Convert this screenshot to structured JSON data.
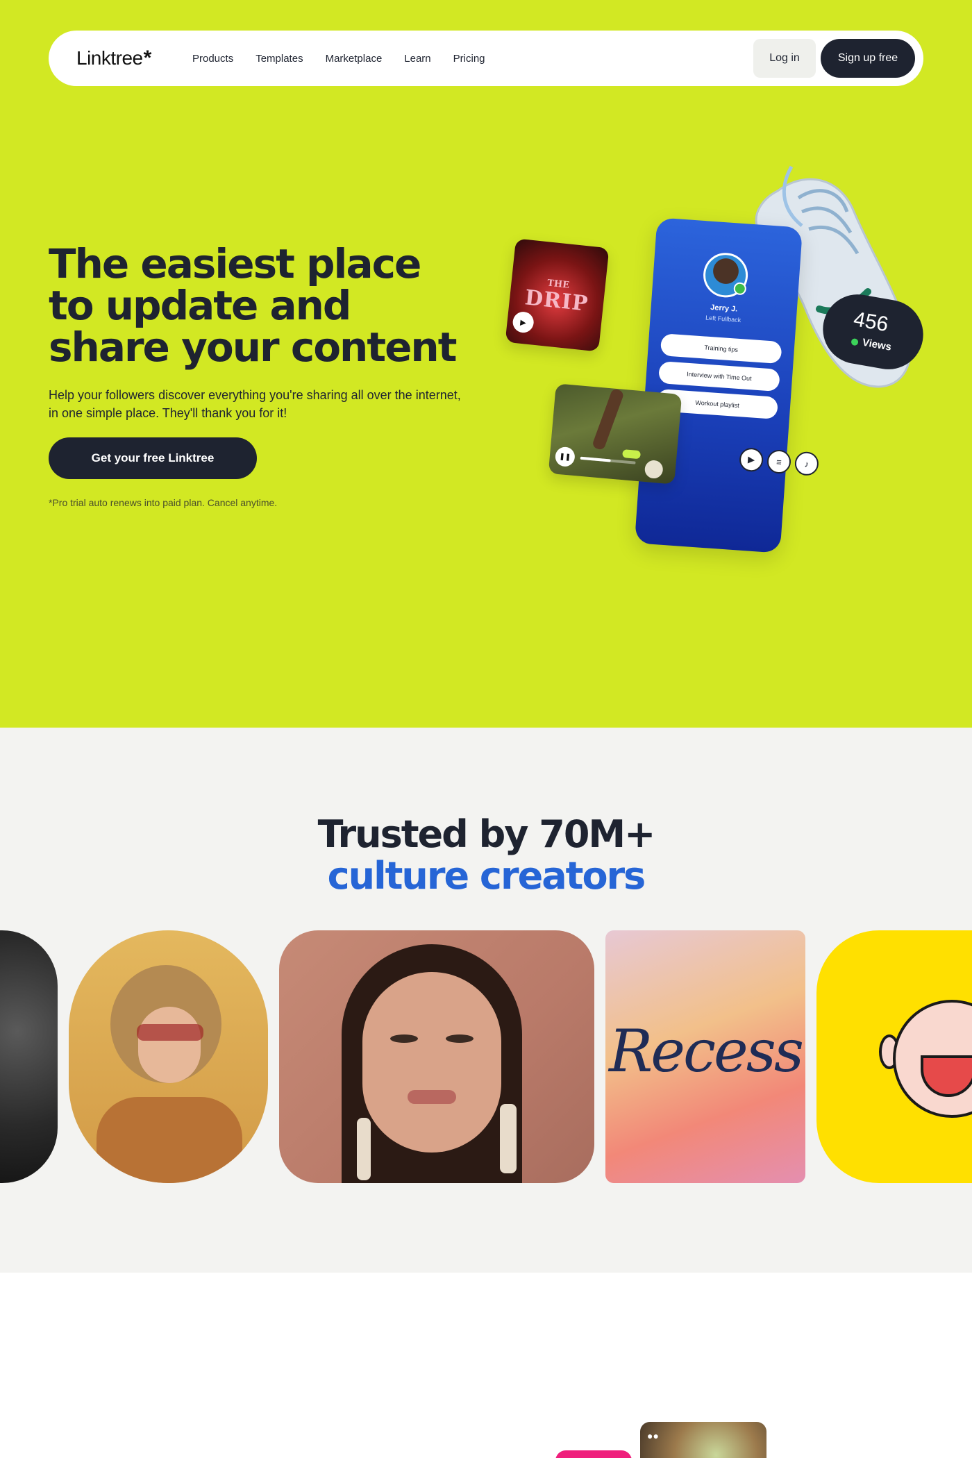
{
  "brand": {
    "name": "Linktree",
    "mark": "*"
  },
  "nav": {
    "links": [
      "Products",
      "Templates",
      "Marketplace",
      "Learn",
      "Pricing"
    ],
    "login": "Log in",
    "signup": "Sign up free"
  },
  "hero": {
    "title_line1": "The easiest place",
    "title_line2": "to update and",
    "title_line3": "share your content",
    "subtitle_line1": "Help your followers discover everything you're sharing all over the internet,",
    "subtitle_line2": "in one simple place. They'll thank you for it!",
    "cta": "Get your free Linktree",
    "note": "*Pro trial auto renews into paid plan. Cancel anytime."
  },
  "mockup": {
    "profile_name": "Jerry J.",
    "profile_role": "Left Fullback",
    "links": [
      "Training tips",
      "Interview with Time Out",
      "Workout playlist"
    ],
    "drip_small": "THE",
    "drip_big": "DRIP",
    "views_count": "456",
    "views_label": "Views",
    "video_progress": 0.55,
    "social_icons": [
      "youtube-icon",
      "spotify-icon",
      "tiktok-icon"
    ]
  },
  "trusted": {
    "title": "Trusted by 70M+",
    "accent": "culture creators",
    "accent_color": "#2665d6",
    "recess_label": "Recess"
  },
  "colors": {
    "hero_bg": "#d2e823",
    "dark": "#1e2330",
    "trusted_bg": "#f3f3f1",
    "phone_blue": "#2c64dc",
    "pink": "#ef1f7c"
  }
}
